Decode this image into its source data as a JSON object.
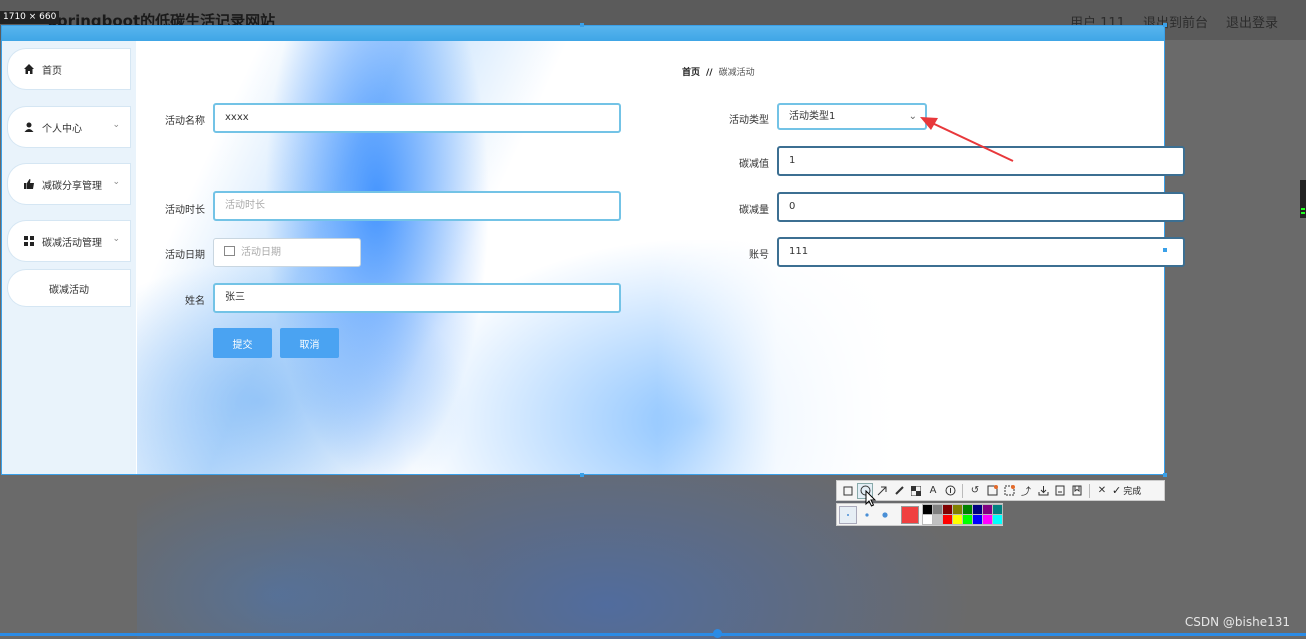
{
  "app": {
    "title": "springboot的低碳生活记录网站",
    "size_badge": "1710 × 660",
    "header_links": [
      "用户 111",
      "退出到前台",
      "退出登录"
    ]
  },
  "sidebar": {
    "items": [
      {
        "label": "首页",
        "icon": "home-icon"
      },
      {
        "label": "个人中心",
        "icon": "user-icon"
      },
      {
        "label": "减碳分享管理",
        "icon": "thumb-icon"
      },
      {
        "label": "碳减活动管理",
        "icon": "grid-icon"
      }
    ],
    "sub_item": "碳减活动"
  },
  "breadcrumb": {
    "home": "首页",
    "separator": "//",
    "current": "碳减活动"
  },
  "form": {
    "activity_name": {
      "label": "活动名称",
      "value": "xxxx"
    },
    "activity_type": {
      "label": "活动类型",
      "value": "活动类型1"
    },
    "carbon_value": {
      "label": "碳减值",
      "value": "1"
    },
    "duration": {
      "label": "活动时长",
      "placeholder": "活动时长"
    },
    "carbon_amount": {
      "label": "碳减量",
      "value": "0"
    },
    "date": {
      "label": "活动日期",
      "placeholder": "活动日期"
    },
    "account": {
      "label": "账号",
      "value": "111"
    },
    "name": {
      "label": "姓名",
      "value": "张三"
    },
    "submit_label": "提交",
    "cancel_label": "取消"
  },
  "toolbar": {
    "tools": [
      "rect-tool-icon",
      "ellipse-tool-icon",
      "arrow-tool-icon",
      "pen-tool-icon",
      "mosaic-tool-icon",
      "text-tool-icon",
      "serial-tool-icon",
      "undo-icon",
      "ocr-icon",
      "translate-icon",
      "pin-icon",
      "download-icon",
      "save-icon",
      "bookmark-icon",
      "close-icon"
    ],
    "done_label": "完成",
    "colors": [
      "#000000",
      "#808080",
      "#800000",
      "#808000",
      "#008000",
      "#000080",
      "#800080",
      "#008080",
      "#ffffff",
      "#c0c0c0",
      "#ff0000",
      "#ffff00",
      "#00ff00",
      "#0000ff",
      "#ff00ff",
      "#00ffff"
    ],
    "current_color": "#f04040"
  },
  "watermark": "CSDN @bishe131"
}
